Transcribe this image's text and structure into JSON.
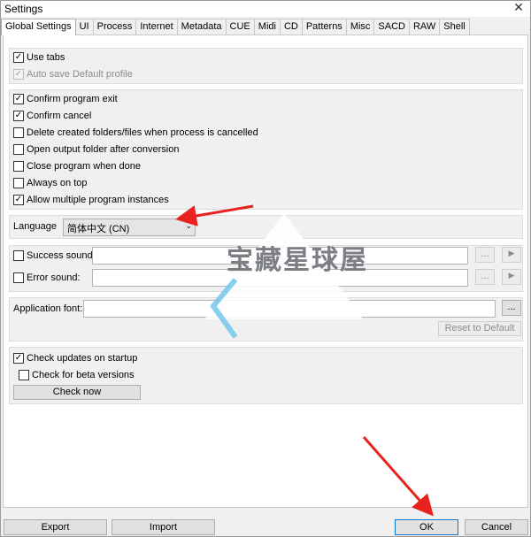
{
  "window": {
    "title": "Settings"
  },
  "tabs": [
    {
      "label": "Global Settings",
      "active": true
    },
    {
      "label": "UI"
    },
    {
      "label": "Process"
    },
    {
      "label": "Internet"
    },
    {
      "label": "Metadata"
    },
    {
      "label": "CUE"
    },
    {
      "label": "Midi"
    },
    {
      "label": "CD"
    },
    {
      "label": "Patterns"
    },
    {
      "label": "Misc"
    },
    {
      "label": "SACD"
    },
    {
      "label": "RAW"
    },
    {
      "label": "Shell"
    }
  ],
  "group1": {
    "use_tabs": {
      "label": "Use tabs",
      "checked": true
    },
    "auto_save": {
      "label": "Auto save Default profile",
      "checked": true,
      "disabled": true
    }
  },
  "group2": {
    "confirm_exit": {
      "label": "Confirm program exit",
      "checked": true
    },
    "confirm_cancel": {
      "label": "Confirm cancel",
      "checked": true
    },
    "delete_created": {
      "label": "Delete created folders/files when process is cancelled",
      "checked": false
    },
    "open_output": {
      "label": "Open output folder after conversion",
      "checked": false
    },
    "close_done": {
      "label": "Close program when done",
      "checked": false
    },
    "always_top": {
      "label": "Always on top",
      "checked": false
    },
    "allow_multiple": {
      "label": "Allow multiple program instances",
      "checked": true
    }
  },
  "language": {
    "label": "Language",
    "value": "简体中文 (CN)"
  },
  "sounds": {
    "success": {
      "label": "Success sound:",
      "checked": false,
      "browse": "..."
    },
    "error": {
      "label": "Error sound:",
      "checked": false,
      "browse": "..."
    }
  },
  "font": {
    "label": "Application font:",
    "browse": "...",
    "reset": "Reset to Default"
  },
  "updates": {
    "check_startup": {
      "label": "Check updates on startup",
      "checked": true
    },
    "check_beta": {
      "label": "Check for beta versions",
      "checked": false
    },
    "check_now": "Check now"
  },
  "footer": {
    "export": "Export",
    "import": "Import",
    "ok": "OK",
    "cancel": "Cancel"
  },
  "watermark": "宝藏星球屋",
  "colors": {
    "arrow": "#e8231f",
    "accent": "#0078d7"
  },
  "icons": {
    "close": "close-icon",
    "check": "checkmark-icon",
    "play": "play-icon",
    "dropdown": "chevron-down-icon"
  }
}
